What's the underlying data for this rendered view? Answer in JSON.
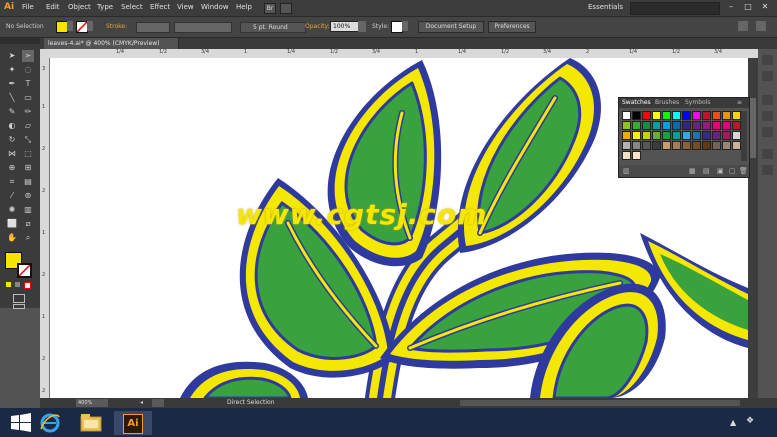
{
  "app": {
    "logo": "Ai"
  },
  "menu": [
    "File",
    "Edit",
    "Object",
    "Type",
    "Select",
    "Effect",
    "View",
    "Window",
    "Help"
  ],
  "workspace": "Essentials",
  "control": {
    "selection_label": "No Selection",
    "stroke_label": "Stroke:",
    "brush_label": "5 pt. Round",
    "opacity_label": "Opacity:",
    "opacity_value": "100%",
    "style_label": "Style:",
    "document_setup": "Document Setup",
    "preferences": "Preferences",
    "fill_color": "#f5e400"
  },
  "document_tab": "leaves-4.ai* @ 400% (CMYK/Preview)",
  "ruler": {
    "top_ticks": [
      "1/4",
      "1/2",
      "3/4",
      "1",
      "1/4",
      "1/2",
      "3/4",
      "1",
      "1/4",
      "1/2",
      "3/4",
      "2",
      "1/4",
      "1/2",
      "3/4"
    ],
    "left_ticks": [
      "3",
      "1",
      "2",
      "2",
      "1",
      "2",
      "1",
      "2",
      "2"
    ]
  },
  "swatches_panel": {
    "tabs": [
      "Swatches",
      "Brushes",
      "Symbols"
    ],
    "colors": [
      "#ffffff",
      "#000000",
      "#ff0000",
      "#ffff00",
      "#00ff00",
      "#00ffff",
      "#0000ff",
      "#ff00ff",
      "#c8102e",
      "#e94e1b",
      "#f39200",
      "#ffd500",
      "#95c11f",
      "#3aaa35",
      "#009640",
      "#00a19a",
      "#009fe3",
      "#0069b4",
      "#312783",
      "#662483",
      "#951b81",
      "#e6007e",
      "#e5007d",
      "#be1622",
      "#f7a600",
      "#fff200",
      "#c6d300",
      "#6ab023",
      "#1d9f3c",
      "#00a09a",
      "#36a9e1",
      "#1d71b8",
      "#2d2e83",
      "#662382",
      "#a3195b",
      "#d6d6d6",
      "#b2b2b2",
      "#878787",
      "#575756",
      "#3c3c3b",
      "#c69c6d",
      "#a67c52",
      "#8c6239",
      "#754c24",
      "#603813",
      "#736357",
      "#998675",
      "#c7b299",
      "#f2e2c4",
      "#ffe3c5"
    ]
  },
  "status": {
    "zoom": "400%",
    "tool": "Direct Selection"
  },
  "watermark": "www.cgtsj.com",
  "taskbar": {
    "icons": [
      "windows-start",
      "internet-explorer",
      "file-explorer",
      "illustrator"
    ]
  },
  "leaf_colors": {
    "outline": "#2e3a9e",
    "border": "#f5e800",
    "fill": "#3aa13f"
  }
}
